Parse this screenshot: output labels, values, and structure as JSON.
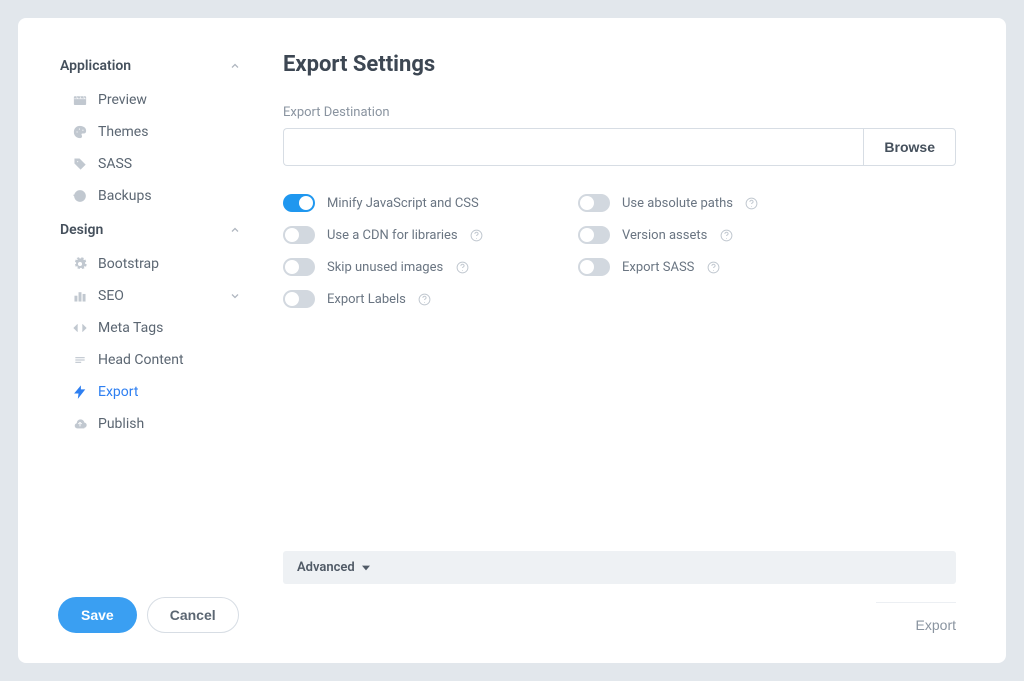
{
  "sidebar": {
    "groups": [
      {
        "label": "Application",
        "expanded": true,
        "items": [
          {
            "id": "preview",
            "label": "Preview",
            "icon": "clapperboard-icon"
          },
          {
            "id": "themes",
            "label": "Themes",
            "icon": "palette-icon"
          },
          {
            "id": "sass",
            "label": "SASS",
            "icon": "tags-icon"
          },
          {
            "id": "backups",
            "label": "Backups",
            "icon": "history-icon"
          }
        ]
      },
      {
        "label": "Design",
        "expanded": true,
        "items": [
          {
            "id": "bootstrap",
            "label": "Bootstrap",
            "icon": "gear-icon"
          },
          {
            "id": "seo",
            "label": "SEO",
            "icon": "chart-bar-icon",
            "submenu": true
          },
          {
            "id": "meta-tags",
            "label": "Meta Tags",
            "icon": "code-icon"
          },
          {
            "id": "head-content",
            "label": "Head Content",
            "icon": "lines-icon"
          },
          {
            "id": "export",
            "label": "Export",
            "icon": "bolt-icon",
            "active": true
          },
          {
            "id": "publish",
            "label": "Publish",
            "icon": "cloud-upload-icon"
          }
        ]
      }
    ]
  },
  "footer": {
    "save": "Save",
    "cancel": "Cancel"
  },
  "page": {
    "title": "Export Settings",
    "destination_label": "Export Destination",
    "destination_value": "",
    "browse": "Browse",
    "options": [
      {
        "id": "minify",
        "label": "Minify JavaScript and CSS",
        "on": true,
        "help": false
      },
      {
        "id": "absolute-paths",
        "label": "Use absolute paths",
        "on": false,
        "help": true
      },
      {
        "id": "cdn",
        "label": "Use a CDN for libraries",
        "on": false,
        "help": true
      },
      {
        "id": "version-assets",
        "label": "Version assets",
        "on": false,
        "help": true
      },
      {
        "id": "skip-images",
        "label": "Skip unused images",
        "on": false,
        "help": true
      },
      {
        "id": "export-sass",
        "label": "Export SASS",
        "on": false,
        "help": true
      },
      {
        "id": "export-labels",
        "label": "Export Labels",
        "on": false,
        "help": true
      }
    ],
    "advanced": "Advanced",
    "export_action": "Export"
  }
}
